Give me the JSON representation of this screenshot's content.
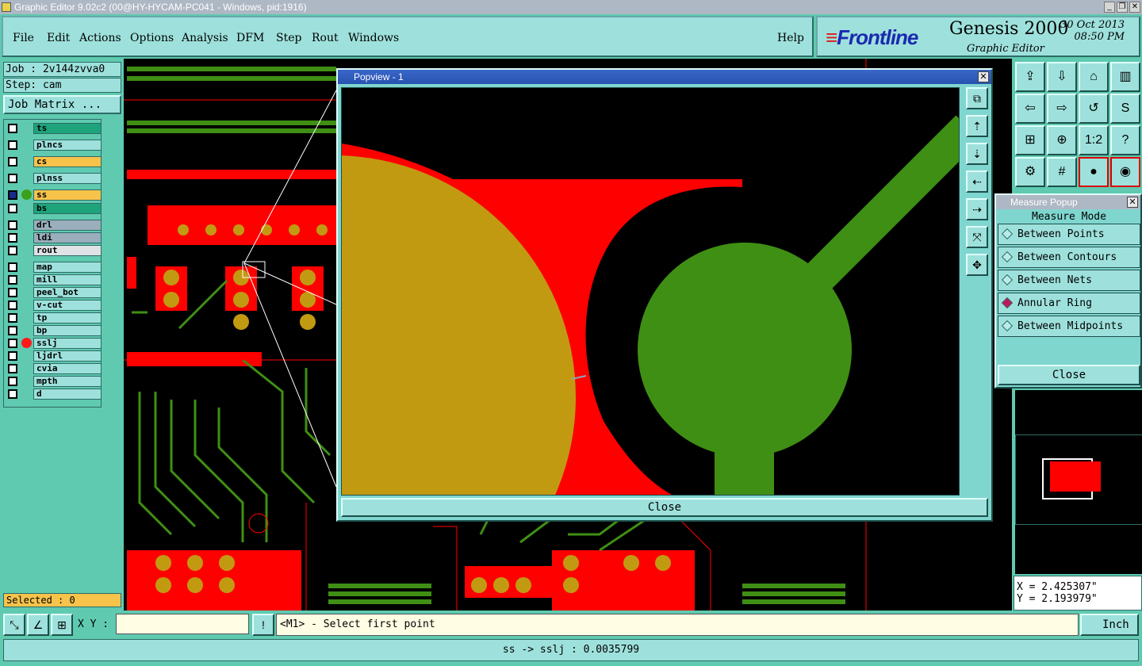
{
  "window": {
    "title": "Graphic Editor 9.02c2 (00@HY-HYCAM-PC041 - Windows, pid:1916)"
  },
  "menu": {
    "items": [
      "File",
      "Edit",
      "Actions",
      "Options",
      "Analysis",
      "DFM",
      "Step",
      "Rout",
      "Windows"
    ],
    "help": "Help"
  },
  "brand": {
    "logo": "Frontline",
    "product": "Genesis 2000",
    "subtitle": "Graphic Editor",
    "date": "30 Oct 2013",
    "time": "08:50 PM"
  },
  "job": {
    "job_label": "Job : 2v144zvva0",
    "step_label": "Step: cam",
    "matrix_button": "Job Matrix ..."
  },
  "layers": [
    {
      "name": "ts",
      "color": "#1fa37a"
    },
    {
      "name": "plncs",
      "color": "#9ee1dc"
    },
    {
      "name": "cs",
      "color": "#f7c34a"
    },
    {
      "name": "plnss",
      "color": "#9ee1dc"
    },
    {
      "name": "ss",
      "color": "#f7c34a",
      "work": true,
      "dot": "#3aa01a"
    },
    {
      "name": "bs",
      "color": "#1fa37a"
    },
    {
      "name": "drl",
      "color": "#9aaebb"
    },
    {
      "name": "ldi",
      "color": "#9aaebb"
    },
    {
      "name": "rout",
      "color": "#dfe3e6"
    },
    {
      "name": "map",
      "color": "#9ee1dc"
    },
    {
      "name": "mill",
      "color": "#9ee1dc"
    },
    {
      "name": "peel_bot",
      "color": "#9ee1dc"
    },
    {
      "name": "v-cut",
      "color": "#9ee1dc"
    },
    {
      "name": "tp",
      "color": "#9ee1dc"
    },
    {
      "name": "bp",
      "color": "#9ee1dc"
    },
    {
      "name": "sslj",
      "color": "#9ee1dc",
      "dot": "#ff1a1a"
    },
    {
      "name": "ljdrl",
      "color": "#9ee1dc"
    },
    {
      "name": "cvia",
      "color": "#9ee1dc"
    },
    {
      "name": "mpth",
      "color": "#9ee1dc"
    },
    {
      "name": "d",
      "color": "#9ee1dc"
    }
  ],
  "selected": {
    "label": "Selected : 0"
  },
  "popview": {
    "title": "Popview - 1",
    "close": "Close"
  },
  "measure": {
    "title": "Measure Popup",
    "header": "Measure Mode",
    "options": [
      "Between Points",
      "Between Contours",
      "Between Nets",
      "Annular Ring",
      "Between Midpoints"
    ],
    "selected_option": "Annular Ring",
    "close": "Close"
  },
  "coords": {
    "x": "X = 2.425307\"",
    "y": "Y = 2.193979\""
  },
  "input": {
    "xy_label": "X Y :",
    "xy_value": "",
    "prompt": "<M1> - Select first point",
    "units": "Inch"
  },
  "status": {
    "message": "ss -> sslj : 0.0035799"
  },
  "colors": {
    "copper_red": "#ff0000",
    "pad_gold": "#c29a12",
    "trace_green": "#3f8f14",
    "panel": "#5fcab0"
  }
}
